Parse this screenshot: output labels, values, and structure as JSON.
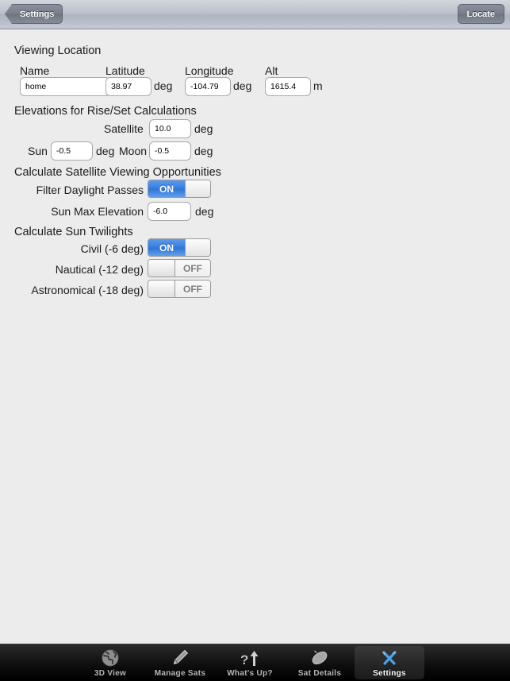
{
  "navbar": {
    "back_label": "Settings",
    "locate_label": "Locate"
  },
  "sections": {
    "viewing_location": {
      "title": "Viewing Location",
      "fields": [
        {
          "label": "Name",
          "value": "home",
          "unit": ""
        },
        {
          "label": "Latitude",
          "value": "38.97",
          "unit": "deg"
        },
        {
          "label": "Longitude",
          "value": "-104.79",
          "unit": "deg"
        },
        {
          "label": "Alt",
          "value": "1615.4",
          "unit": "m"
        }
      ]
    },
    "elevations": {
      "title": "Elevations for Rise/Set Calculations",
      "satellite": {
        "label": "Satellite",
        "value": "10.0",
        "unit": "deg"
      },
      "sun": {
        "label": "Sun",
        "value": "-0.5",
        "unit": "deg"
      },
      "moon": {
        "label": "Moon",
        "value": "-0.5",
        "unit": "deg"
      }
    },
    "satellite_viewing": {
      "title": "Calculate Satellite Viewing Opportunities",
      "filter_daylight": {
        "label": "Filter Daylight Passes",
        "state": "ON"
      },
      "sun_max_elevation": {
        "label": "Sun Max Elevation",
        "value": "-6.0",
        "unit": "deg"
      }
    },
    "sun_twilights": {
      "title": "Calculate Sun Twilights",
      "civil": {
        "label": "Civil (-6 deg)",
        "state": "ON"
      },
      "nautical": {
        "label": "Nautical (-12 deg)",
        "state": "OFF"
      },
      "astronomical": {
        "label": "Astronomical (-18 deg)",
        "state": "OFF"
      }
    }
  },
  "tabbar": {
    "tabs": [
      {
        "label": "3D View",
        "icon": "globe-icon",
        "active": false
      },
      {
        "label": "Manage Sats",
        "icon": "pencil-icon",
        "active": false
      },
      {
        "label": "What's Up?",
        "icon": "question-arrow-icon",
        "active": false
      },
      {
        "label": "Sat Details",
        "icon": "satellite-dish-icon",
        "active": false
      },
      {
        "label": "Settings",
        "icon": "tools-icon",
        "active": true
      }
    ]
  },
  "colors": {
    "accent_blue": "#357fe0",
    "background": "#ececec",
    "tabbar_active_icon": "#4aa3e8"
  }
}
